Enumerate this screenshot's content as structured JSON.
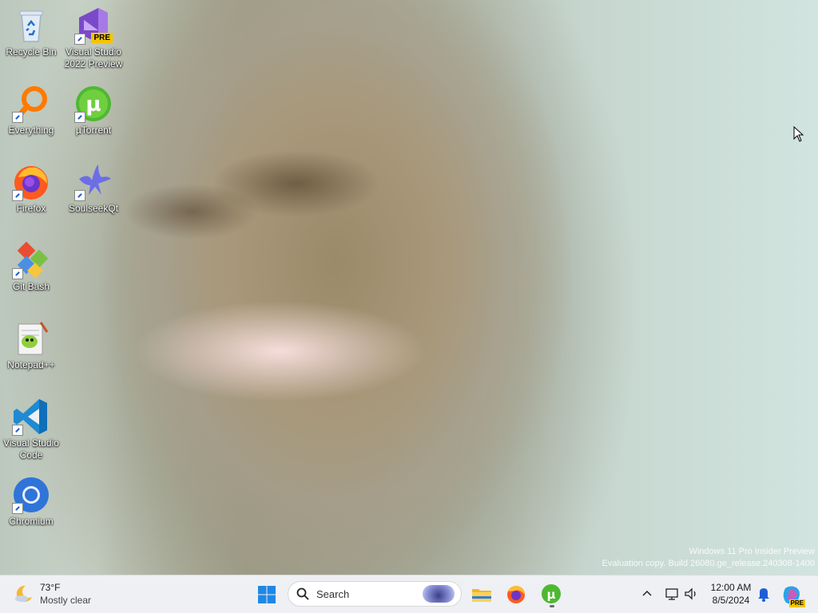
{
  "desktop": {
    "icons": [
      {
        "label_line1": "Recycle Bin",
        "label_line2": ""
      },
      {
        "label_line1": "Visual Studio",
        "label_line2": "2022 Preview",
        "badge": "PRE"
      },
      {
        "label_line1": "Everything",
        "label_line2": ""
      },
      {
        "label_line1": "µTorrent",
        "label_line2": ""
      },
      {
        "label_line1": "Firefox",
        "label_line2": ""
      },
      {
        "label_line1": "SoulseekQt",
        "label_line2": ""
      },
      {
        "label_line1": "Git Bash",
        "label_line2": ""
      },
      {
        "label_line1": "Notepad++",
        "label_line2": ""
      },
      {
        "label_line1": "Visual Studio",
        "label_line2": "Code"
      },
      {
        "label_line1": "Chromium",
        "label_line2": ""
      }
    ],
    "watermark": {
      "line1": "Windows 11 Pro Insider Preview",
      "line2": "Evaluation copy. Build 26080.ge_release.240308-1400"
    }
  },
  "taskbar": {
    "weather": {
      "temperature": "73°F",
      "condition": "Mostly clear"
    },
    "search": {
      "placeholder": "Search"
    },
    "pinned": [
      "start-icon",
      "file-explorer-icon",
      "firefox-icon",
      "utorrent-icon"
    ],
    "clock": {
      "time": "12:00 AM",
      "date": "8/5/2024"
    },
    "copilot_badge": "PRE"
  },
  "colors": {
    "taskbar_bg": "#eef0f4",
    "accent_blue": "#0078d4",
    "utorrent_green": "#4eb832"
  }
}
